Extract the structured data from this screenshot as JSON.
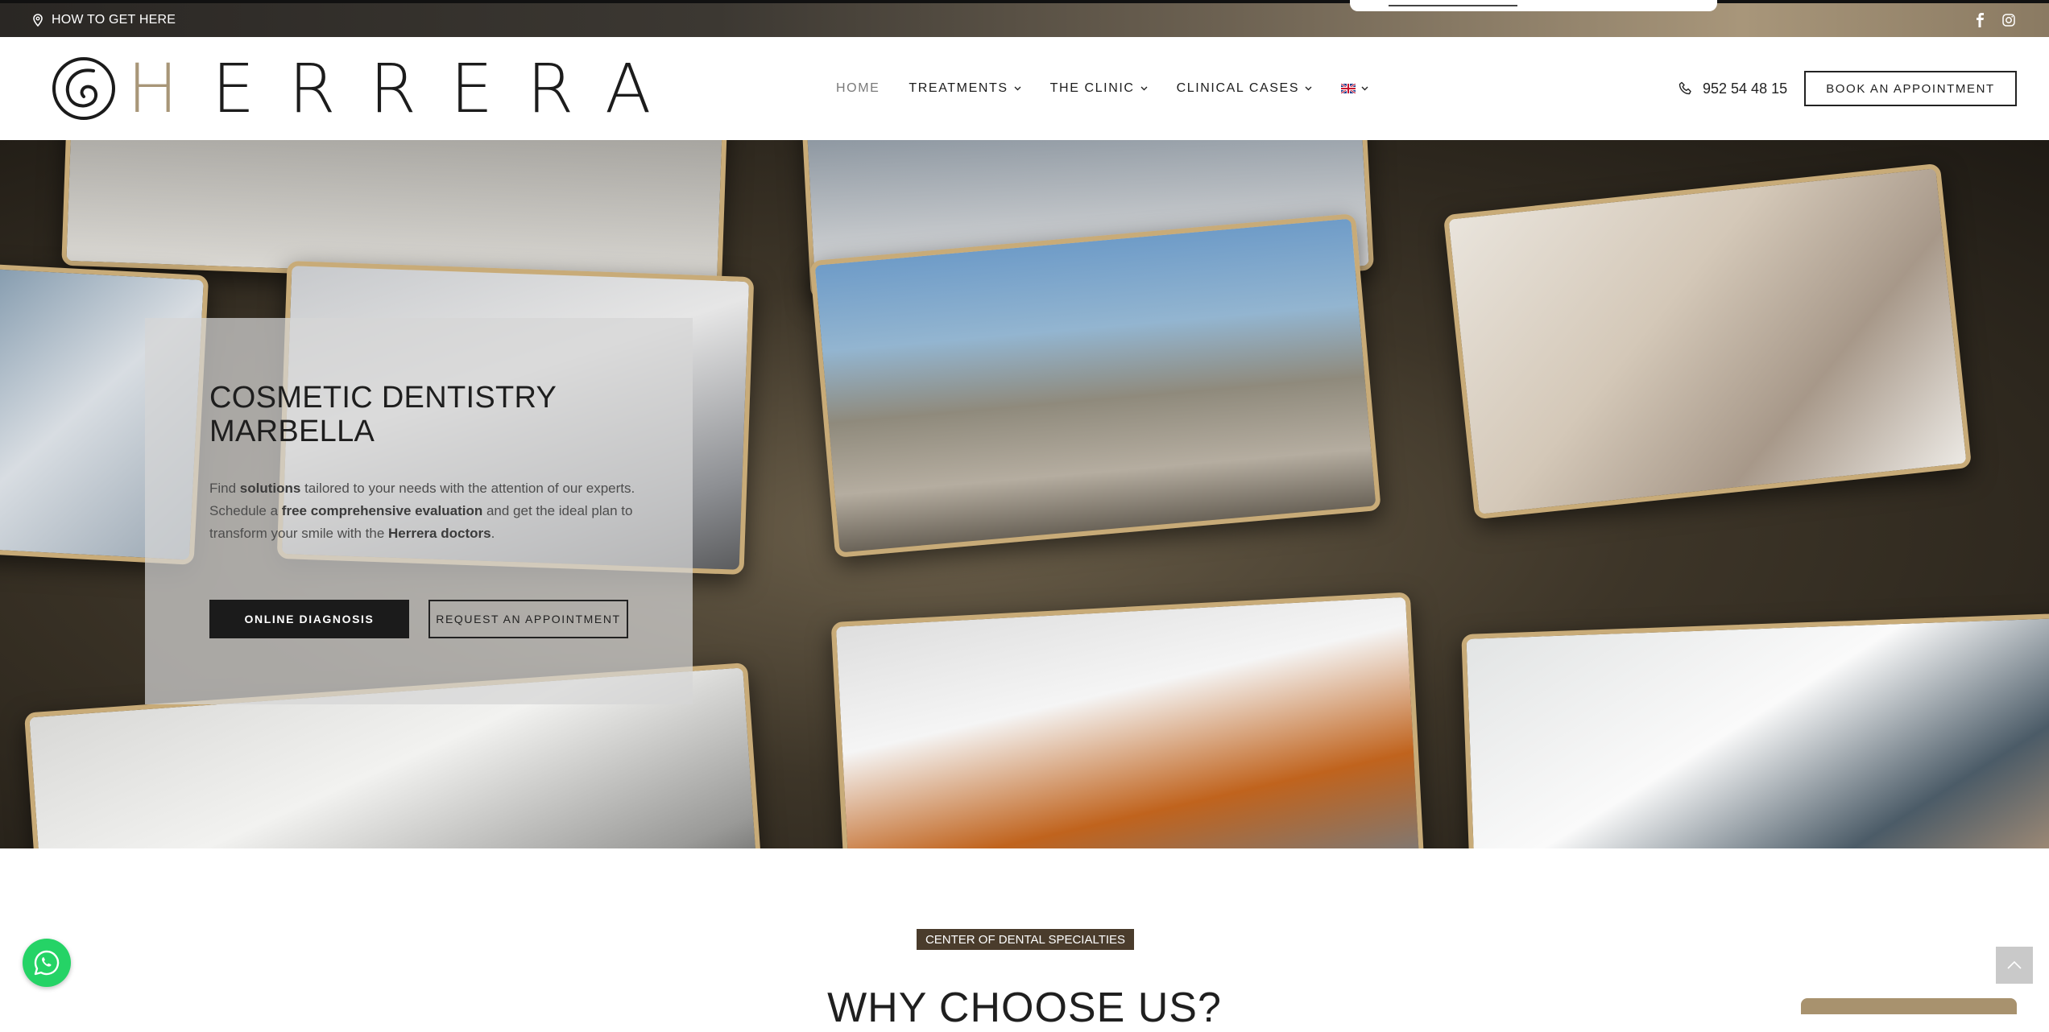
{
  "topbar": {
    "how_to_get_here": "HOW TO GET HERE",
    "social": [
      "facebook-icon",
      "instagram-icon"
    ]
  },
  "header": {
    "logo_text": "HERRERA",
    "nav": [
      {
        "label": "HOME",
        "active": true,
        "has_dropdown": false
      },
      {
        "label": "TREATMENTS",
        "active": false,
        "has_dropdown": true
      },
      {
        "label": "THE CLINIC",
        "active": false,
        "has_dropdown": true
      },
      {
        "label": "CLINICAL CASES",
        "active": false,
        "has_dropdown": true
      }
    ],
    "language_flag": "uk-flag-icon",
    "phone": "952 54 48 15",
    "book_label": "BOOK AN APPOINTMENT"
  },
  "hero": {
    "title_line1": "COSMETIC DENTISTRY",
    "title_line2": "MARBELLA",
    "text_1": "Find ",
    "text_bold_1": "solutions",
    "text_2": " tailored to your needs with the attention of our experts. Schedule a ",
    "text_bold_2": "free comprehensive evaluation",
    "text_3": " and get the ideal plan to transform your smile with the ",
    "text_bold_3": "Herrera doctors",
    "text_4": ".",
    "btn_online": "ONLINE DIAGNOSIS",
    "btn_request": "REQUEST AN APPOINTMENT"
  },
  "section": {
    "badge": "CENTER OF DENTAL SPECIALTIES",
    "title": "WHY CHOOSE US?"
  },
  "colors": {
    "accent_gold": "#a89678",
    "badge_brown": "#4a3c2c",
    "whatsapp_green": "#25d366"
  }
}
